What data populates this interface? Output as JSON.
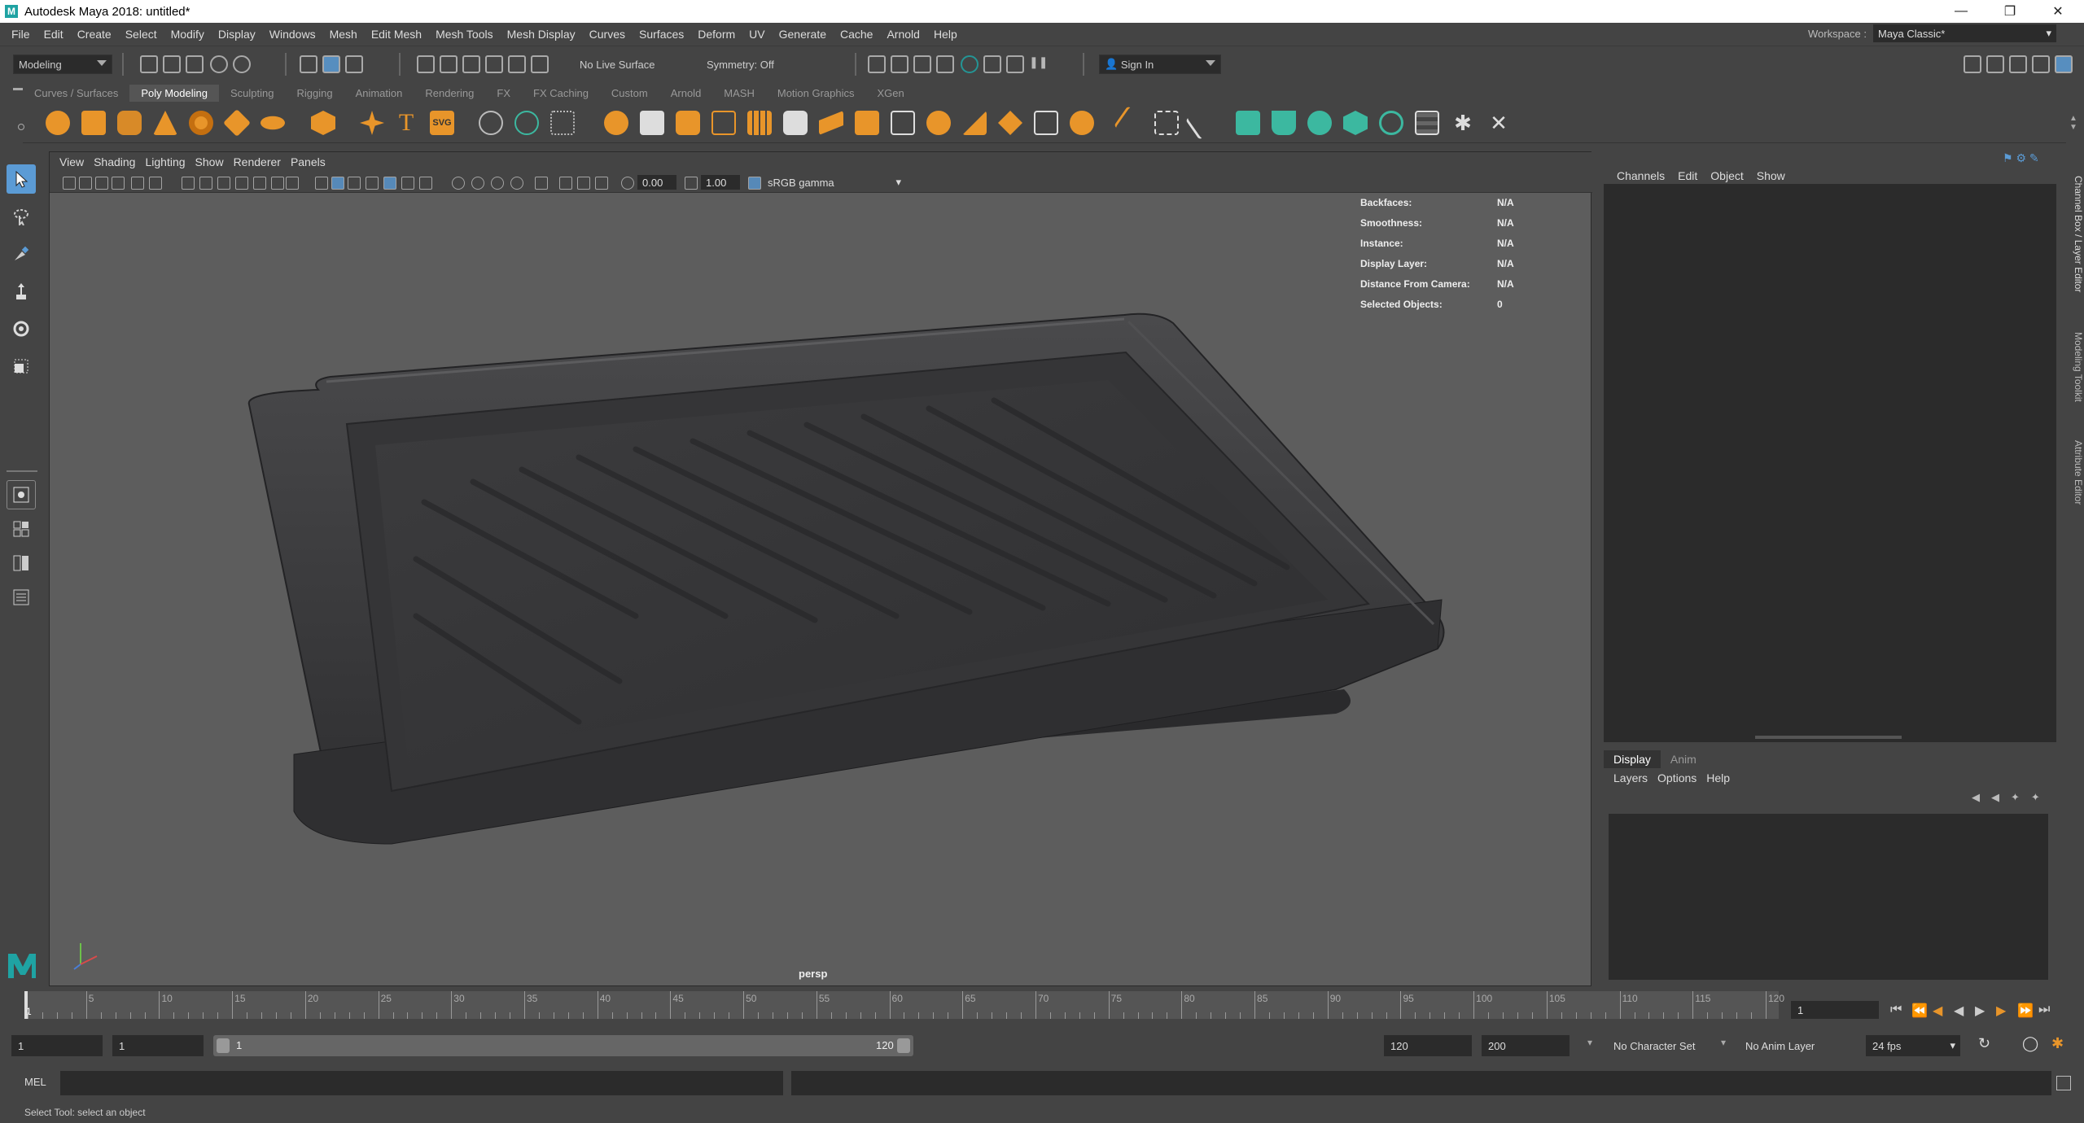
{
  "window": {
    "title": "Autodesk Maya 2018: untitled*"
  },
  "menubar": {
    "items": [
      "File",
      "Edit",
      "Create",
      "Select",
      "Modify",
      "Display",
      "Windows",
      "Mesh",
      "Edit Mesh",
      "Mesh Tools",
      "Mesh Display",
      "Curves",
      "Surfaces",
      "Deform",
      "UV",
      "Generate",
      "Cache",
      "Arnold",
      "Help"
    ],
    "workspace_label": "Workspace :",
    "workspace_value": "Maya Classic*"
  },
  "statusline": {
    "mode": "Modeling",
    "live_surface": "No Live Surface",
    "symmetry": "Symmetry: Off",
    "sign_in": "Sign In"
  },
  "shelf": {
    "tabs": [
      "Curves / Surfaces",
      "Poly Modeling",
      "Sculpting",
      "Rigging",
      "Animation",
      "Rendering",
      "FX",
      "FX Caching",
      "Custom",
      "Arnold",
      "MASH",
      "Motion Graphics",
      "XGen"
    ],
    "active_tab": "Poly Modeling"
  },
  "viewport": {
    "menu": [
      "View",
      "Shading",
      "Lighting",
      "Show",
      "Renderer",
      "Panels"
    ],
    "exposure": "0.00",
    "gamma": "1.00",
    "color_space": "sRGB gamma",
    "camera": "persp",
    "hud": [
      {
        "label": "Backfaces:",
        "value": "N/A"
      },
      {
        "label": "Smoothness:",
        "value": "N/A"
      },
      {
        "label": "Instance:",
        "value": "N/A"
      },
      {
        "label": "Display Layer:",
        "value": "N/A"
      },
      {
        "label": "Distance From Camera:",
        "value": "N/A"
      },
      {
        "label": "Selected Objects:",
        "value": "0"
      }
    ]
  },
  "channelbox": {
    "menu": [
      "Channels",
      "Edit",
      "Object",
      "Show"
    ]
  },
  "layer_editor": {
    "tabs": [
      "Display",
      "Anim"
    ],
    "active_tab": "Display",
    "menu": [
      "Layers",
      "Options",
      "Help"
    ]
  },
  "side_tabs": [
    "Channel Box / Layer Editor",
    "Modeling Toolkit",
    "Attribute Editor"
  ],
  "timeslider": {
    "ticks": [
      5,
      10,
      15,
      20,
      25,
      30,
      35,
      40,
      45,
      50,
      55,
      60,
      65,
      70,
      75,
      80,
      85,
      90,
      95,
      100,
      105,
      110,
      115,
      120
    ],
    "start_label": "1",
    "current_frame": "1"
  },
  "range": {
    "anim_start": "1",
    "playback_start": "1",
    "slider_start": "1",
    "slider_end": "120",
    "playback_end": "120",
    "anim_end": "200",
    "character_set": "No Character Set",
    "anim_layer": "No Anim Layer",
    "fps": "24 fps"
  },
  "cmdline": {
    "label": "MEL"
  },
  "helpline": {
    "text": "Select Tool: select an object"
  },
  "colors": {
    "accent": "#5b9bd5",
    "maya_teal": "#1fa3a3",
    "shelf_orange": "#e8952a",
    "shelf_green": "#3cb8a0"
  }
}
